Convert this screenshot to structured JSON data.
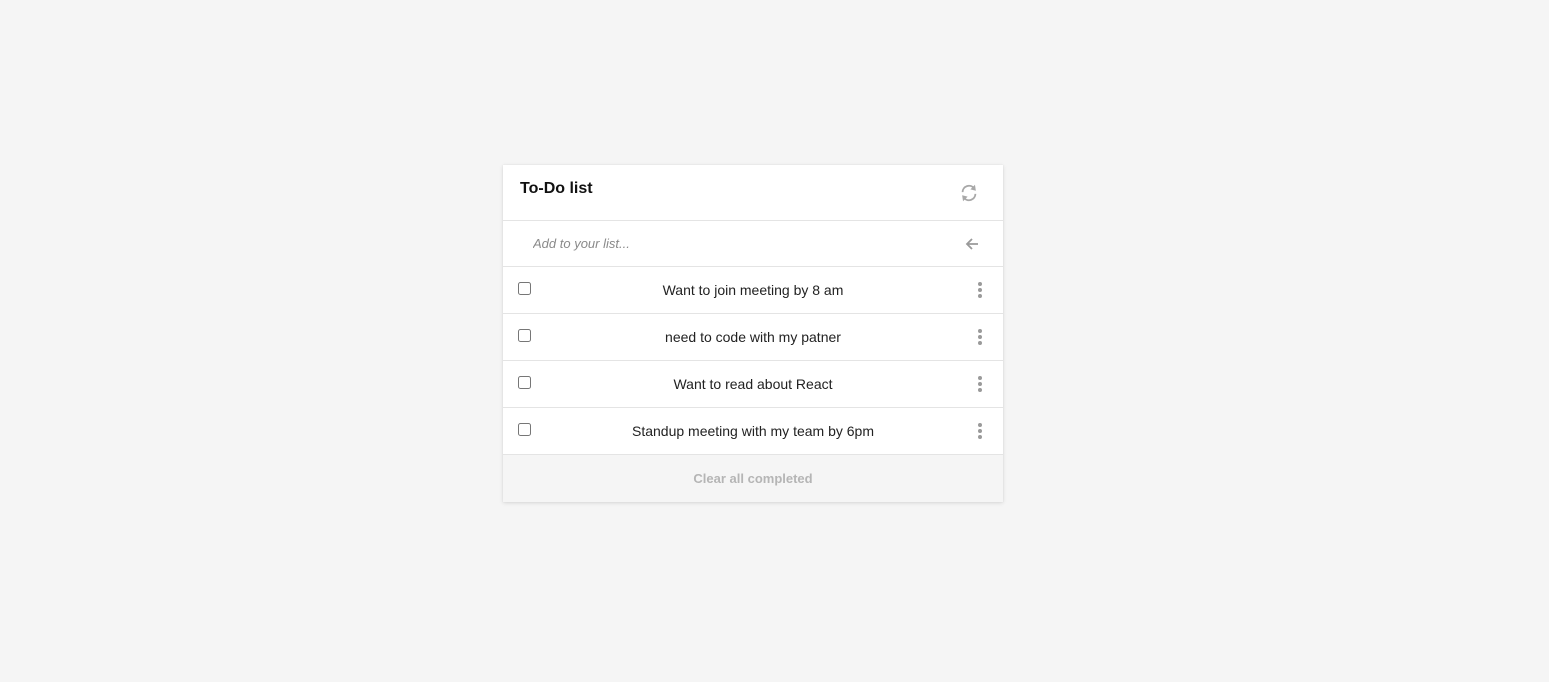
{
  "card": {
    "title": "To-Do list",
    "refresh_icon": "refresh-icon"
  },
  "add": {
    "placeholder": "Add to your list...",
    "value": "",
    "submit_icon": "arrow-left-icon"
  },
  "todos": [
    {
      "text": "Want to join meeting by 8 am",
      "checked": false
    },
    {
      "text": "need to code with my patner",
      "checked": false
    },
    {
      "text": "Want to read about React",
      "checked": false
    },
    {
      "text": "Standup meeting with my team by 6pm",
      "checked": false
    }
  ],
  "footer": {
    "clear_label": "Clear all completed"
  },
  "colors": {
    "background": "#f5f5f5",
    "card": "#ffffff",
    "icon": "#9a9a9a",
    "muted_text": "#b5b5b5"
  }
}
